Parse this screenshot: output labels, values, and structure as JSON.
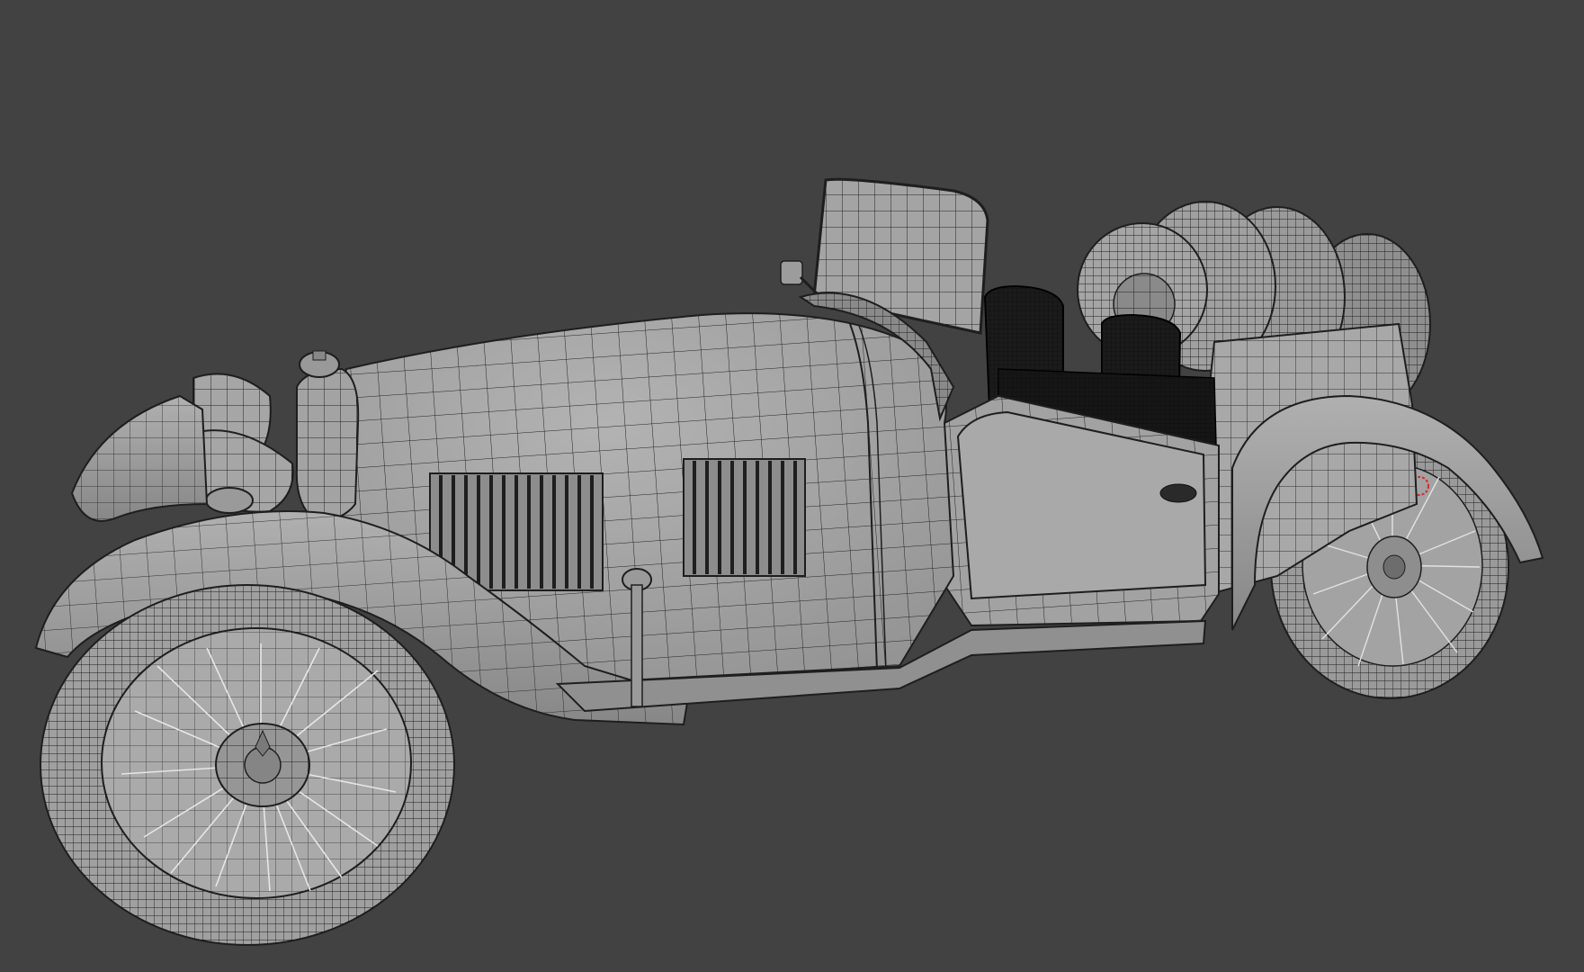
{
  "viewport": {
    "background_color": "#424242",
    "mesh_fill_color": "#a6a6a6",
    "mesh_shadow_color": "#7e7e7e",
    "wire_color": "#1e1e1e",
    "seat_color": "#1b1b1b",
    "selection_color": "#d32a2a",
    "object": "wireframe-car-model"
  }
}
